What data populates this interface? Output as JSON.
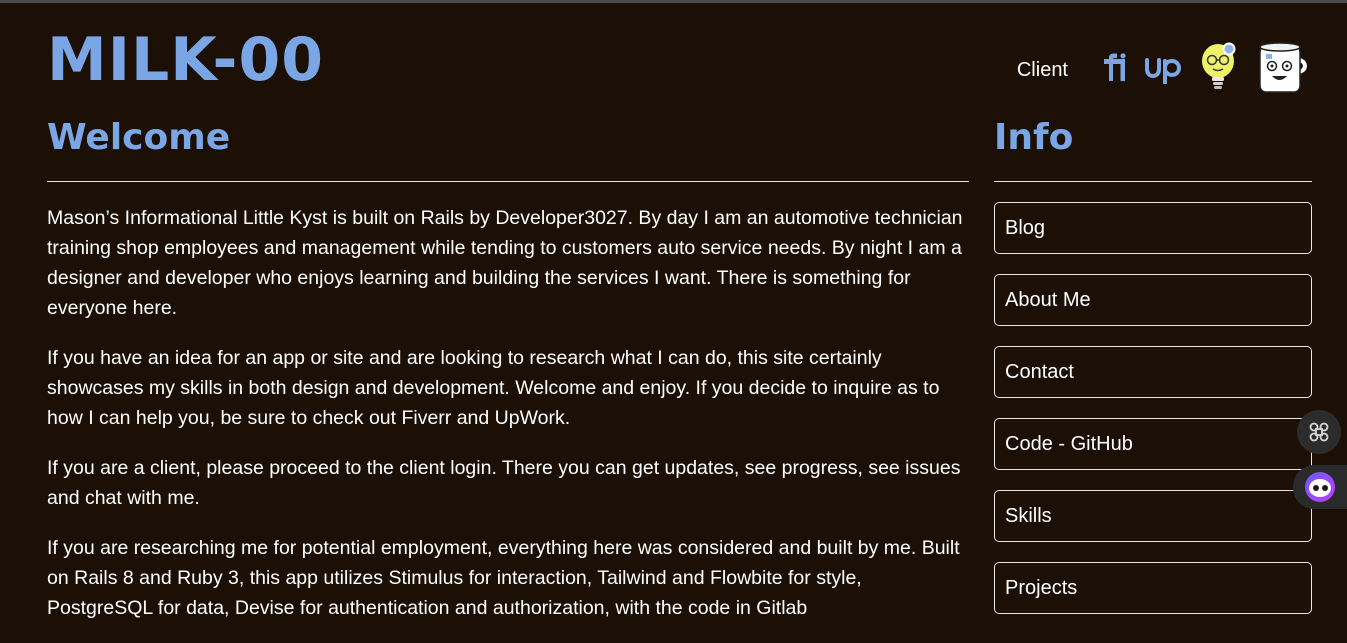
{
  "header": {
    "logo": "MILK-00",
    "client_link": "Client",
    "icons": [
      "fiverr-icon",
      "upwork-icon",
      "lightbulb-character-icon",
      "milk-cup-character-icon"
    ]
  },
  "main": {
    "title": "Welcome",
    "paragraphs": [
      "Mason’s Informational Little Kyst is built on Rails by Developer3027. By day I am an automotive technician training shop employees and management while tending to customers auto service needs. By night I am a designer and developer who enjoys learning and building the services I want. There is something for everyone here.",
      "If you have an idea for an app or site and are looking to research what I can do, this site certainly showcases my skills in both design and development. Welcome and enjoy. If you decide to inquire as to how I can help you, be sure to check out Fiverr and UpWork.",
      "If you are a client, please proceed to the client login. There you can get updates, see progress, see issues and chat with me.",
      "If you are researching me for potential employment, everything here was considered and built by me. Built on Rails 8 and Ruby 3, this app utilizes Stimulus for interaction, Tailwind and Flowbite for style, PostgreSQL for data, Devise for authentication and authorization, with the code in Gitlab"
    ]
  },
  "sidebar": {
    "title": "Info",
    "items": [
      {
        "label": "Blog"
      },
      {
        "label": "About Me"
      },
      {
        "label": "Contact"
      },
      {
        "label": "Code - GitHub"
      },
      {
        "label": "Skills"
      },
      {
        "label": "Projects"
      }
    ]
  },
  "floating": [
    "command-grid-icon",
    "assistant-eyes-icon"
  ],
  "colors": {
    "background": "#1c0f06",
    "accent": "#7aa6e6",
    "text": "#ffffff",
    "rule": "#e6e6e6"
  }
}
